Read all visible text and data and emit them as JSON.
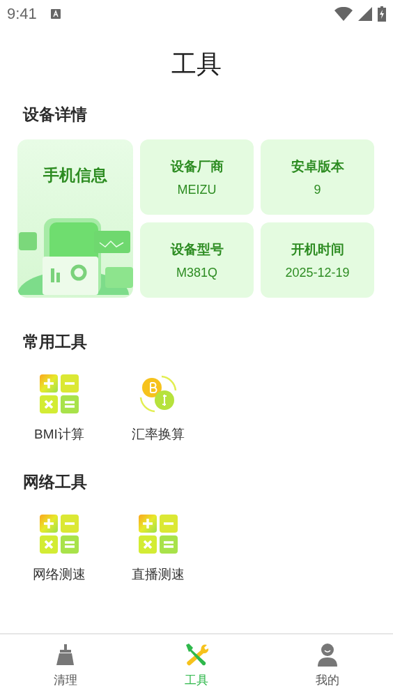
{
  "status_bar": {
    "time": "9:41"
  },
  "page_title": "工具",
  "device_section": {
    "title": "设备详情",
    "feature_card": {
      "title": "手机信息"
    },
    "items": [
      {
        "label": "设备厂商",
        "value": "MEIZU"
      },
      {
        "label": "安卓版本",
        "value": "9"
      },
      {
        "label": "设备型号",
        "value": "M381Q"
      },
      {
        "label": "开机时间",
        "value": "2025-12-19"
      }
    ]
  },
  "tool_sections": [
    {
      "title": "常用工具",
      "tools": [
        {
          "kind": "calculator",
          "label": "BMI计算"
        },
        {
          "kind": "exchange",
          "label": "汇率换算"
        }
      ]
    },
    {
      "title": "网络工具",
      "tools": [
        {
          "kind": "calculator",
          "label": "网络测速"
        },
        {
          "kind": "calculator",
          "label": "直播测速"
        }
      ]
    }
  ],
  "bottom_nav": [
    {
      "kind": "broom",
      "label": "清理",
      "selected": false
    },
    {
      "kind": "tools",
      "label": "工具",
      "selected": true
    },
    {
      "kind": "person",
      "label": "我的",
      "selected": false
    }
  ]
}
